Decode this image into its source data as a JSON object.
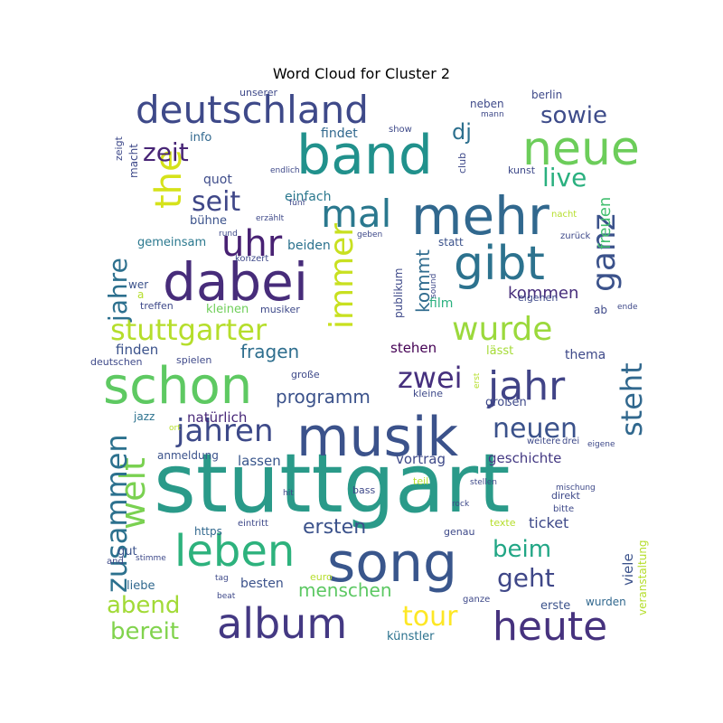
{
  "chart_data": {
    "type": "wordcloud",
    "title": "Word Cloud for Cluster 2",
    "background": "#ffffff",
    "colormap": "viridis",
    "words": [
      {
        "text": "stuttgart",
        "weight": 100,
        "color": "#2a9a89"
      },
      {
        "text": "musik",
        "weight": 62,
        "color": "#3b528b"
      },
      {
        "text": "band",
        "weight": 58,
        "color": "#21918c"
      },
      {
        "text": "song",
        "weight": 56,
        "color": "#39568c"
      },
      {
        "text": "mehr",
        "weight": 55,
        "color": "#31688e"
      },
      {
        "text": "dabei",
        "weight": 55,
        "color": "#472c7a"
      },
      {
        "text": "schon",
        "weight": 52,
        "color": "#5ec962"
      },
      {
        "text": "neue",
        "weight": 52,
        "color": "#6ccd5a"
      },
      {
        "text": "leben",
        "weight": 50,
        "color": "#2db27d"
      },
      {
        "text": "gibt",
        "weight": 50,
        "color": "#2c728e"
      },
      {
        "text": "mal",
        "weight": 48,
        "color": "#2a788e"
      },
      {
        "text": "deutschland",
        "weight": 44,
        "color": "#3e4989"
      },
      {
        "text": "album",
        "weight": 44,
        "color": "#443983"
      },
      {
        "text": "heute",
        "weight": 44,
        "color": "#46327e"
      },
      {
        "text": "jahr",
        "weight": 42,
        "color": "#414487"
      },
      {
        "text": "welt",
        "weight": 40,
        "color": "#7ad151"
      },
      {
        "text": "uhr",
        "weight": 38,
        "color": "#482173"
      },
      {
        "text": "the",
        "weight": 40,
        "color": "#d5e21a"
      },
      {
        "text": "immer",
        "weight": 38,
        "color": "#c8e020"
      },
      {
        "text": "ganz",
        "weight": 38,
        "color": "#3b528b"
      },
      {
        "text": "wurde",
        "weight": 36,
        "color": "#9bd93c"
      },
      {
        "text": "jahren",
        "weight": 34,
        "color": "#3e4a89"
      },
      {
        "text": "zwei",
        "weight": 34,
        "color": "#46307e"
      },
      {
        "text": "zusammen",
        "weight": 34,
        "color": "#2c718e"
      },
      {
        "text": "stuttgarter",
        "weight": 33,
        "color": "#b5de2b"
      },
      {
        "text": "steht",
        "weight": 32,
        "color": "#31688e"
      },
      {
        "text": "neuen",
        "weight": 30,
        "color": "#3b528b"
      },
      {
        "text": "seit",
        "weight": 30,
        "color": "#3f4788"
      },
      {
        "text": "zeit",
        "weight": 28,
        "color": "#482576"
      },
      {
        "text": "jahre",
        "weight": 28,
        "color": "#2d708e"
      },
      {
        "text": "sowie",
        "weight": 26,
        "color": "#3e4c8a"
      },
      {
        "text": "live",
        "weight": 26,
        "color": "#2ab07f"
      },
      {
        "text": "tour",
        "weight": 28,
        "color": "#fde725"
      },
      {
        "text": "abend",
        "weight": 28,
        "color": "#a2da37"
      },
      {
        "text": "geht",
        "weight": 28,
        "color": "#3f4788"
      },
      {
        "text": "beim",
        "weight": 26,
        "color": "#21a685"
      },
      {
        "text": "kommt",
        "weight": 22,
        "color": "#2f6b8e"
      },
      {
        "text": "ersten",
        "weight": 24,
        "color": "#3b528b"
      },
      {
        "text": "dj",
        "weight": 24,
        "color": "#2d708e"
      },
      {
        "text": "menschen",
        "weight": 22,
        "color": "#5cc863"
      },
      {
        "text": "bereit",
        "weight": 24,
        "color": "#81d34d"
      },
      {
        "text": "fragen",
        "weight": 20,
        "color": "#2e6e8e"
      },
      {
        "text": "programm",
        "weight": 20,
        "color": "#3b528b"
      },
      {
        "text": "freuen",
        "weight": 18,
        "color": "#44bf70"
      },
      {
        "text": "kommen",
        "weight": 18,
        "color": "#472d7b"
      },
      {
        "text": "ticket",
        "weight": 16,
        "color": "#3e4989"
      },
      {
        "text": "viele",
        "weight": 16,
        "color": "#3b528b"
      },
      {
        "text": "geschichte",
        "weight": 16,
        "color": "#443983"
      },
      {
        "text": "vortrag",
        "weight": 15,
        "color": "#3e4989"
      },
      {
        "text": "natürlich",
        "weight": 15,
        "color": "#482878"
      },
      {
        "text": "lassen",
        "weight": 15,
        "color": "#39568c"
      },
      {
        "text": "finden",
        "weight": 15,
        "color": "#3b528b"
      },
      {
        "text": "stehen",
        "weight": 15,
        "color": "#440154"
      },
      {
        "text": "film",
        "weight": 14,
        "color": "#2ab07f"
      },
      {
        "text": "thema",
        "weight": 14,
        "color": "#3e4989"
      },
      {
        "text": "beiden",
        "weight": 14,
        "color": "#2c728e"
      },
      {
        "text": "kleinen",
        "weight": 13,
        "color": "#6ece58"
      },
      {
        "text": "bühne",
        "weight": 13,
        "color": "#3b528b"
      },
      {
        "text": "gemeinsam",
        "weight": 13,
        "color": "#2a788e"
      },
      {
        "text": "einfach",
        "weight": 14,
        "color": "#2a788e"
      },
      {
        "text": "findet",
        "weight": 14,
        "color": "#31688e"
      },
      {
        "text": "quot",
        "weight": 14,
        "color": "#3e4c8a"
      },
      {
        "text": "info",
        "weight": 13,
        "color": "#31688e"
      },
      {
        "text": "macht",
        "weight": 12,
        "color": "#3e4989"
      },
      {
        "text": "zeigt",
        "weight": 11,
        "color": "#3e4989"
      },
      {
        "text": "publikum",
        "weight": 12,
        "color": "#3e4989"
      },
      {
        "text": "lässt",
        "weight": 13,
        "color": "#a5db36"
      },
      {
        "text": "großen",
        "weight": 13,
        "color": "#3e4989"
      },
      {
        "text": "besten",
        "weight": 14,
        "color": "#3b528b"
      },
      {
        "text": "liebe",
        "weight": 13,
        "color": "#31688e"
      },
      {
        "text": "künstler",
        "weight": 13,
        "color": "#2c728e"
      },
      {
        "text": "erste",
        "weight": 13,
        "color": "#3b528b"
      },
      {
        "text": "wurden",
        "weight": 12,
        "color": "#31688e"
      },
      {
        "text": "veranstaltung",
        "weight": 12,
        "color": "#b5de2b"
      },
      {
        "text": "statt",
        "weight": 12,
        "color": "#3b528b"
      },
      {
        "text": "neben",
        "weight": 12,
        "color": "#3e4989"
      },
      {
        "text": "berlin",
        "weight": 12,
        "color": "#3e4989"
      },
      {
        "text": "club",
        "weight": 11,
        "color": "#3e4989"
      },
      {
        "text": "kunst",
        "weight": 11,
        "color": "#3e4989"
      },
      {
        "text": "gut",
        "weight": 13,
        "color": "#3b528b"
      },
      {
        "text": "https",
        "weight": 12,
        "color": "#31688e"
      },
      {
        "text": "anmeldung",
        "weight": 12,
        "color": "#3b528b"
      },
      {
        "text": "jazz",
        "weight": 12,
        "color": "#2c728e"
      },
      {
        "text": "deutschen",
        "weight": 11,
        "color": "#3e4989"
      },
      {
        "text": "spielen",
        "weight": 11,
        "color": "#3e4989"
      },
      {
        "text": "große",
        "weight": 11,
        "color": "#3e4989"
      },
      {
        "text": "kleine",
        "weight": 11,
        "color": "#3e4989"
      },
      {
        "text": "eigenen",
        "weight": 11,
        "color": "#3e4989"
      },
      {
        "text": "treffen",
        "weight": 11,
        "color": "#3e4989"
      },
      {
        "text": "musiker",
        "weight": 11,
        "color": "#3e4989"
      },
      {
        "text": "konzert",
        "weight": 10,
        "color": "#3e4989"
      },
      {
        "text": "wer",
        "weight": 12,
        "color": "#3b528b"
      },
      {
        "text": "eintritt",
        "weight": 10,
        "color": "#3e4989"
      },
      {
        "text": "bass",
        "weight": 11,
        "color": "#3e4989"
      },
      {
        "text": "genau",
        "weight": 11,
        "color": "#3e4989"
      },
      {
        "text": "direkt",
        "weight": 11,
        "color": "#3e4989"
      },
      {
        "text": "bitte",
        "weight": 10,
        "color": "#3e4989"
      },
      {
        "text": "euro",
        "weight": 11,
        "color": "#b5de2b"
      },
      {
        "text": "ganze",
        "weight": 10,
        "color": "#3e4989"
      },
      {
        "text": "texte",
        "weight": 11,
        "color": "#b5de2b"
      },
      {
        "text": "teil",
        "weight": 11,
        "color": "#b5de2b"
      },
      {
        "text": "unserer",
        "weight": 11,
        "color": "#3e4989"
      },
      {
        "text": "show",
        "weight": 10,
        "color": "#3e4989"
      },
      {
        "text": "nacht",
        "weight": 10,
        "color": "#b5de2b"
      },
      {
        "text": "zurück",
        "weight": 10,
        "color": "#3e4989"
      },
      {
        "text": "ab",
        "weight": 12,
        "color": "#3e4989"
      },
      {
        "text": "ende",
        "weight": 9,
        "color": "#3e4989"
      },
      {
        "text": "weitere",
        "weight": 10,
        "color": "#3e4989"
      },
      {
        "text": "drei",
        "weight": 10,
        "color": "#3e4989"
      },
      {
        "text": "eigene",
        "weight": 9,
        "color": "#3e4989"
      },
      {
        "text": "stellen",
        "weight": 9,
        "color": "#3e4989"
      },
      {
        "text": "mischung",
        "weight": 9,
        "color": "#3e4989"
      },
      {
        "text": "rock",
        "weight": 9,
        "color": "#3e4989"
      },
      {
        "text": "hit",
        "weight": 9,
        "color": "#3e4989"
      },
      {
        "text": "beat",
        "weight": 9,
        "color": "#3e4989"
      },
      {
        "text": "tag",
        "weight": 9,
        "color": "#3e4989"
      },
      {
        "text": "and",
        "weight": 10,
        "color": "#3e4989"
      },
      {
        "text": "stimme",
        "weight": 9,
        "color": "#3e4989"
      },
      {
        "text": "rund",
        "weight": 9,
        "color": "#3e4989"
      },
      {
        "text": "erzählt",
        "weight": 9,
        "color": "#3e4989"
      },
      {
        "text": "fünf",
        "weight": 9,
        "color": "#3e4989"
      },
      {
        "text": "endlich",
        "weight": 9,
        "color": "#3e4989"
      },
      {
        "text": "mann",
        "weight": 9,
        "color": "#3e4989"
      },
      {
        "text": "geben",
        "weight": 9,
        "color": "#3e4989"
      },
      {
        "text": "sound",
        "weight": 9,
        "color": "#3e4989"
      },
      {
        "text": "erst",
        "weight": 9,
        "color": "#b5de2b"
      },
      {
        "text": "ort",
        "weight": 9,
        "color": "#b5de2b"
      },
      {
        "text": "a",
        "weight": 12,
        "color": "#b5de2b"
      }
    ]
  }
}
